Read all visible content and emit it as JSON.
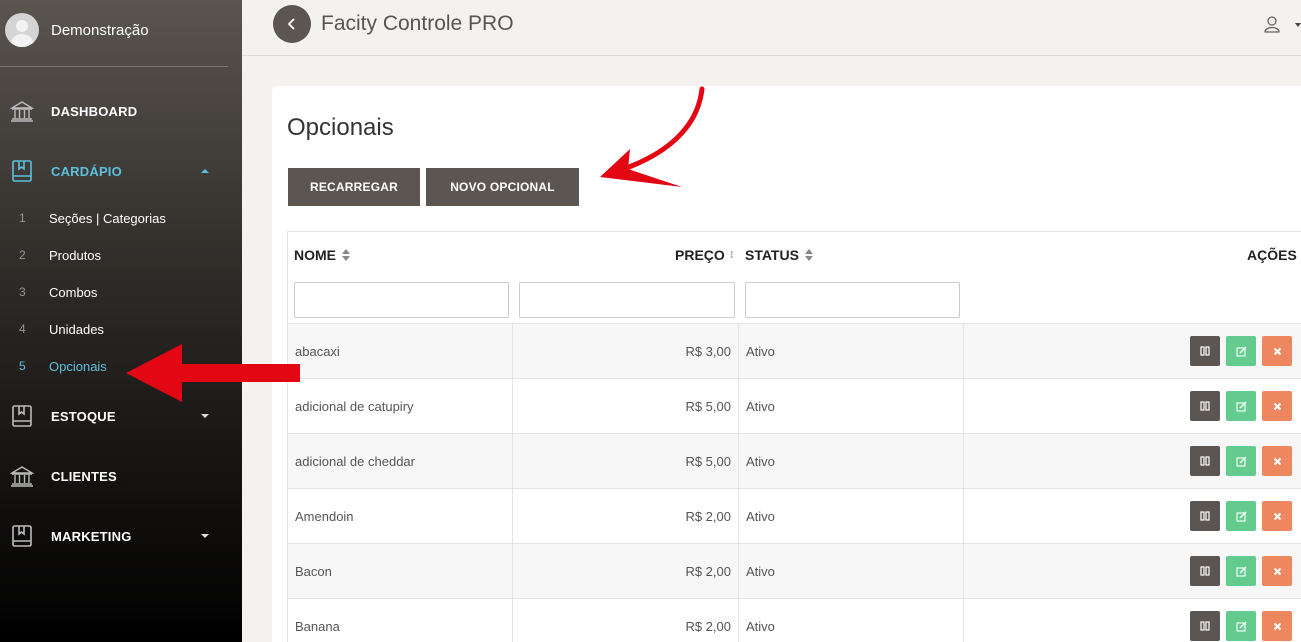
{
  "sidebar": {
    "user_name": "Demonstração",
    "items": [
      {
        "label": "DASHBOARD",
        "icon": "bank-icon"
      },
      {
        "label": "CARDÁPIO",
        "icon": "book-icon",
        "active": true
      },
      {
        "label": "ESTOQUE",
        "icon": "book-icon"
      },
      {
        "label": "CLIENTES",
        "icon": "bank-icon"
      },
      {
        "label": "MARKETING",
        "icon": "book-icon"
      }
    ],
    "submenu": [
      {
        "num": "1",
        "label": "Seções | Categorias"
      },
      {
        "num": "2",
        "label": "Produtos"
      },
      {
        "num": "3",
        "label": "Combos"
      },
      {
        "num": "4",
        "label": "Unidades"
      },
      {
        "num": "5",
        "label": "Opcionais",
        "active": true
      }
    ]
  },
  "header": {
    "title": "Facity Controle PRO"
  },
  "main": {
    "page_title": "Opcionais",
    "buttons": {
      "reload": "RECARREGAR",
      "new": "NOVO OPCIONAL"
    },
    "table": {
      "columns": [
        "NOME",
        "PREÇO",
        "STATUS",
        "AÇÕES"
      ],
      "rows": [
        {
          "name": "abacaxi",
          "price": "R$ 3,00",
          "status": "Ativo"
        },
        {
          "name": "adicional de catupiry",
          "price": "R$ 5,00",
          "status": "Ativo"
        },
        {
          "name": "adicional de cheddar",
          "price": "R$ 5,00",
          "status": "Ativo"
        },
        {
          "name": "Amendoin",
          "price": "R$ 2,00",
          "status": "Ativo"
        },
        {
          "name": "Bacon",
          "price": "R$ 2,00",
          "status": "Ativo"
        },
        {
          "name": "Banana",
          "price": "R$ 2,00",
          "status": "Ativo"
        }
      ]
    }
  },
  "colors": {
    "accent": "#5bc0de",
    "button": "#5b5651",
    "edit": "#62cb8d",
    "delete": "#ee8660",
    "annotation": "#e30613"
  }
}
